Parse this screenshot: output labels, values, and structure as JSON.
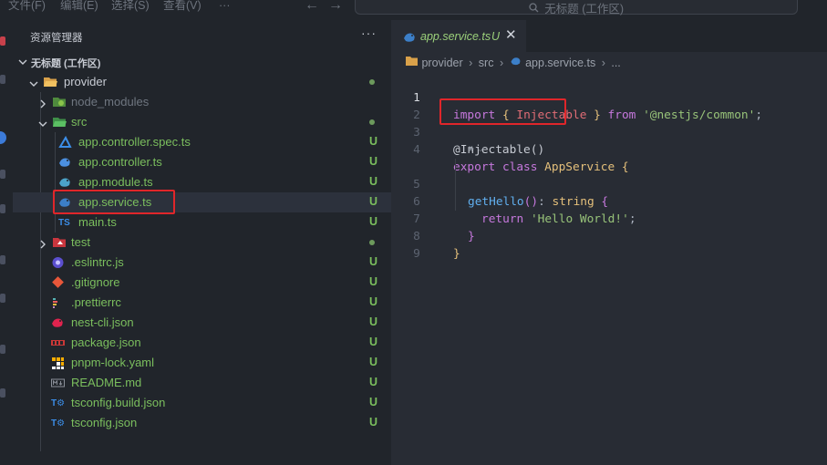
{
  "titlebar": {
    "menu": [
      "文件(F)",
      "编辑(E)",
      "选择(S)",
      "查看(V)",
      "···"
    ],
    "back_arrow": "←",
    "forward_arrow": "→",
    "search_icon": "search-icon",
    "search_text": "无标题 (工作区)"
  },
  "sidebar": {
    "title": "资源管理器",
    "more": "···",
    "workspace": "无标题 (工作区)",
    "items": [
      {
        "label": "provider",
        "status": "",
        "icon": "folder-icon"
      },
      {
        "label": "node_modules",
        "status": "",
        "icon": "node-folder-icon"
      },
      {
        "label": "src",
        "status": "",
        "icon": "src-folder-icon"
      },
      {
        "label": "app.controller.spec.ts",
        "status": "U",
        "icon": "test-ts-icon"
      },
      {
        "label": "app.controller.ts",
        "status": "U",
        "icon": "nest-controller-icon"
      },
      {
        "label": "app.module.ts",
        "status": "U",
        "icon": "nest-module-icon"
      },
      {
        "label": "app.service.ts",
        "status": "U",
        "icon": "nest-service-icon"
      },
      {
        "label": "main.ts",
        "status": "U",
        "icon": "typescript-icon"
      },
      {
        "label": "test",
        "status": "",
        "icon": "test-folder-icon"
      },
      {
        "label": ".eslintrc.js",
        "status": "U",
        "icon": "eslint-icon"
      },
      {
        "label": ".gitignore",
        "status": "U",
        "icon": "git-icon"
      },
      {
        "label": ".prettierrc",
        "status": "U",
        "icon": "prettier-icon"
      },
      {
        "label": "nest-cli.json",
        "status": "U",
        "icon": "nest-icon"
      },
      {
        "label": "package.json",
        "status": "U",
        "icon": "npm-icon"
      },
      {
        "label": "pnpm-lock.yaml",
        "status": "U",
        "icon": "pnpm-icon"
      },
      {
        "label": "README.md",
        "status": "U",
        "icon": "markdown-icon"
      },
      {
        "label": "tsconfig.build.json",
        "status": "U",
        "icon": "tsconfig-icon"
      },
      {
        "label": "tsconfig.json",
        "status": "U",
        "icon": "tsconfig-icon"
      }
    ]
  },
  "editor": {
    "tab": {
      "label": "app.service.ts",
      "status": "U",
      "close": "✕"
    },
    "breadcrumb": {
      "folder": "provider",
      "sep": "›",
      "src": "src",
      "file": "app.service.ts",
      "more": "..."
    },
    "line_numbers": [
      "1",
      "2",
      "3",
      "4",
      "5",
      "6",
      "7",
      "8",
      "9"
    ],
    "code": {
      "l1_import": "import",
      "l1_open": " { ",
      "l1_id": "Injectable",
      "l1_close": " } ",
      "l1_from": "from",
      "l1_str": " '@nestjs/common'",
      "l1_semi": ";",
      "l3_deco": "@Injectable",
      "l3_paren": "()",
      "l4_export": "export",
      "l4_class": " class ",
      "l4_name": "AppService",
      "l4_brace": " {",
      "codelens": "⚹ ⌵",
      "l5_fn": "getHello",
      "l5_paren": "()",
      "l5_colon": ": ",
      "l5_type": "string",
      "l5_brace": " {",
      "l6_return": "return",
      "l6_str": " 'Hello World!'",
      "l6_semi": ";",
      "l7_close": "}",
      "l8_close": "}"
    }
  },
  "colors": {
    "untracked": "#7bbf5e",
    "highlight_box": "#e0262a",
    "editor_bg": "#282c34",
    "sidebar_bg": "#21252b"
  }
}
